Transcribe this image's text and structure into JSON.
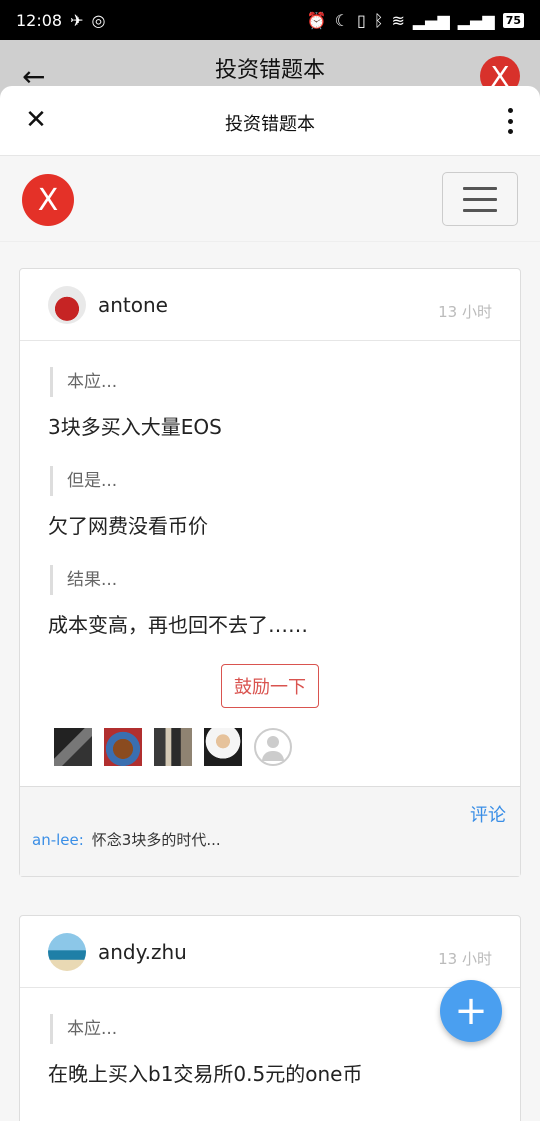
{
  "status_bar": {
    "time": "12:08",
    "battery": "75"
  },
  "behind": {
    "title": "投资错题本",
    "logo": "X"
  },
  "sheet": {
    "title": "投资错题本"
  },
  "navbar": {
    "logo": "X"
  },
  "posts": [
    {
      "username": "antone",
      "time": "13 小时",
      "sections": [
        {
          "label": "本应...",
          "answer": "3块多买入大量EOS"
        },
        {
          "label": "但是...",
          "answer": "欠了网费没看币价"
        },
        {
          "label": "结果...",
          "answer": "成本变高，再也回不去了……"
        }
      ],
      "encourage": "鼓励一下",
      "comment_link": "评论",
      "comment": {
        "user": "an-lee:",
        "text": "怀念3块多的时代..."
      }
    },
    {
      "username": "andy.zhu",
      "time": "13 小时",
      "sections": [
        {
          "label": "本应...",
          "answer": "在晚上买入b1交易所0.5元的one币"
        }
      ]
    }
  ],
  "fab": {
    "label": "+"
  },
  "icons": {
    "back": "arrow-left-icon",
    "close": "close-icon",
    "more": "more-vertical-icon",
    "menu": "hamburger-icon",
    "add": "plus-icon"
  },
  "colors": {
    "accent_blue": "#3a8ee6",
    "encourage_red": "#d9534f",
    "logo_red": "#e43128",
    "fab_blue": "#4a9ff0"
  }
}
